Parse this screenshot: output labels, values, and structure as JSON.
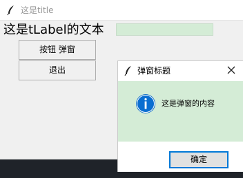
{
  "main_window": {
    "title": "这是title",
    "app_icon": "feather-icon",
    "label_text": "这是tLabel的文本",
    "entry_value": "",
    "buttons": {
      "popup_label": "按钮 弹窗",
      "exit_label": "退出"
    }
  },
  "dialog": {
    "title": "弹窗标题",
    "title_icon": "feather-icon",
    "close_icon": "close-icon",
    "message_icon": "info-icon",
    "message": "这是弹窗的内容",
    "ok_label": "确定"
  },
  "colors": {
    "accent": "#0078d7",
    "panel_green": "#d4ecd6",
    "window_bg": "#f0f0f0",
    "desktop_bg": "#1f2329",
    "title_text": "#999999"
  }
}
